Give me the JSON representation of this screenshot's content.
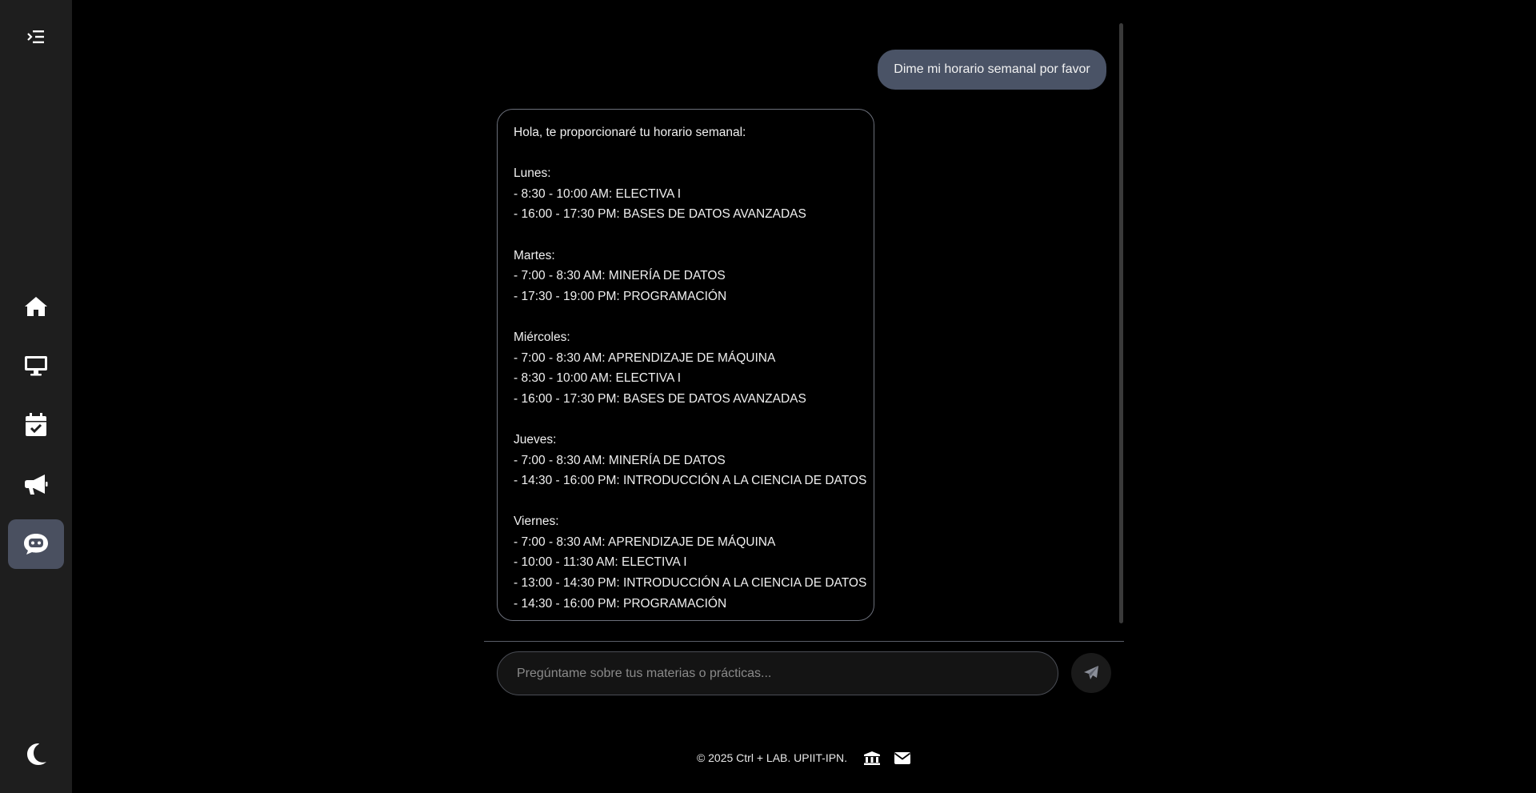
{
  "sidebar": {
    "items": [
      {
        "name": "menu-toggle",
        "icon": "menu-collapse-icon"
      },
      {
        "name": "home",
        "icon": "home-icon"
      },
      {
        "name": "monitor",
        "icon": "monitor-icon"
      },
      {
        "name": "calendar",
        "icon": "calendar-check-icon"
      },
      {
        "name": "announcements",
        "icon": "megaphone-icon"
      },
      {
        "name": "chatbot",
        "icon": "chatbot-icon",
        "active": true
      },
      {
        "name": "theme",
        "icon": "moon-icon"
      }
    ],
    "active_color": "#4a5060"
  },
  "chat": {
    "user_message": "Dime mi horario semanal por favor",
    "bot_lines": [
      "Hola, te proporcionaré tu horario semanal:",
      "",
      "Lunes:",
      "- 8:30 - 10:00 AM: ELECTIVA I",
      "- 16:00 - 17:30 PM: BASES DE DATOS AVANZADAS",
      "",
      "Martes:",
      "- 7:00 - 8:30 AM: MINERÍA DE DATOS",
      "- 17:30 - 19:00 PM: PROGRAMACIÓN",
      "",
      "Miércoles:",
      "- 7:00 - 8:30 AM: APRENDIZAJE DE MÁQUINA",
      "- 8:30 - 10:00 AM: ELECTIVA I",
      "- 16:00 - 17:30 PM: BASES DE DATOS AVANZADAS",
      "",
      "Jueves:",
      "- 7:00 - 8:30 AM: MINERÍA DE DATOS",
      "- 14:30 - 16:00 PM: INTRODUCCIÓN A LA CIENCIA DE DATOS",
      "",
      "Viernes:",
      "- 7:00 - 8:30 AM: APRENDIZAJE DE MÁQUINA",
      "- 10:00 - 11:30 AM: ELECTIVA I",
      "- 13:00 - 14:30 PM: INTRODUCCIÓN A LA CIENCIA DE DATOS",
      "- 14:30 - 16:00 PM: PROGRAMACIÓN"
    ],
    "input_placeholder": "Pregúntame sobre tus materias o prácticas...",
    "send_icon": "send-icon"
  },
  "footer": {
    "text": "© 2025 Ctrl + LAB. UPIIT-IPN.",
    "icons": [
      "institution-icon",
      "mail-icon"
    ]
  }
}
